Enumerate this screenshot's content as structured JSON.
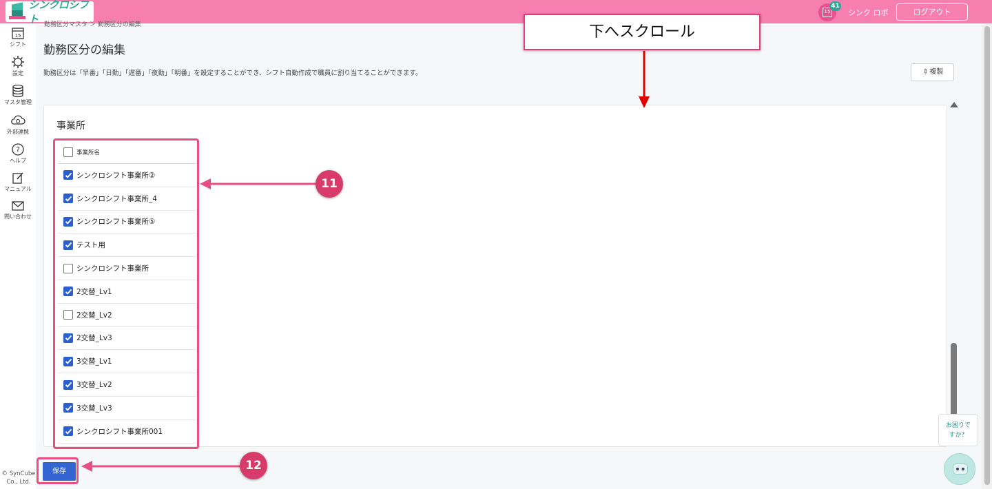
{
  "header": {
    "logo_text": "シンクロシフト",
    "calendar_day": "15",
    "notification_count": "41",
    "user_name": "シンク ロボ",
    "logout_label": "ログアウト",
    "accent_color": "#f77fb0"
  },
  "sidebar": {
    "items": [
      {
        "label": "シフト",
        "icon": "calendar-icon"
      },
      {
        "label": "設定",
        "icon": "gear-icon"
      },
      {
        "label": "マスタ管理",
        "icon": "database-icon"
      },
      {
        "label": "外部連携",
        "icon": "cloud-sync-icon"
      },
      {
        "label": "ヘルプ",
        "icon": "help-icon"
      },
      {
        "label": "マニュアル",
        "icon": "pencil-note-icon"
      },
      {
        "label": "問い合わせ",
        "icon": "mail-icon"
      }
    ],
    "calendar_day": "15",
    "copyright_line1": "© SynCube",
    "copyright_line2": "Co., Ltd."
  },
  "main": {
    "breadcrumb": "勤務区分マスタ ＞ 勤務区分の編集",
    "page_title": "勤務区分の編集",
    "description": "勤務区分は「早番」「日勤」「遅番」「夜勤」「明番」を設定することができ、シフト自動作成で職員に割り当てることができます。",
    "copy_button": "複製",
    "card_title": "事業所",
    "list_header": "事業所名",
    "offices": [
      {
        "name": "シンクロシフト事業所②",
        "checked": true
      },
      {
        "name": "シンクロシフト事業所_4",
        "checked": true
      },
      {
        "name": "シンクロシフト事業所⑤",
        "checked": true
      },
      {
        "name": "テスト用",
        "checked": true
      },
      {
        "name": "シンクロシフト事業所",
        "checked": false
      },
      {
        "name": "2交替_Lv1",
        "checked": true
      },
      {
        "name": "2交替_Lv2",
        "checked": false
      },
      {
        "name": "2交替_Lv3",
        "checked": true
      },
      {
        "name": "3交替_Lv1",
        "checked": true
      },
      {
        "name": "3交替_Lv2",
        "checked": true
      },
      {
        "name": "3交替_Lv3",
        "checked": true
      },
      {
        "name": "シンクロシフト事業所001",
        "checked": true
      }
    ],
    "save_button": "保存"
  },
  "help": {
    "line1": "お困りで",
    "line2": "すか？"
  },
  "annotations": {
    "callout_text": "下へスクロール",
    "step_11": "11",
    "step_12": "12",
    "highlight_color": "#e94d82"
  }
}
